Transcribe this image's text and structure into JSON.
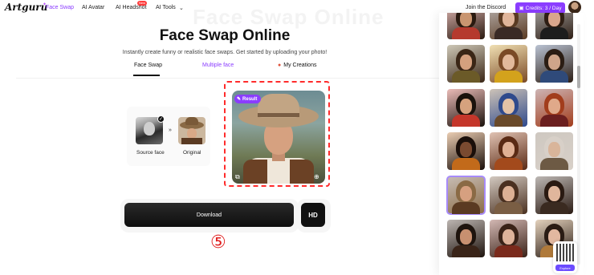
{
  "nav": {
    "logo": "Artguru",
    "items": [
      {
        "label": "Face Swap",
        "active": true
      },
      {
        "label": "AI Avatar"
      },
      {
        "label": "AI Headshot",
        "badge": "New"
      },
      {
        "label": "AI Tools"
      }
    ],
    "discord": "Join the Discord",
    "credits": "Credits: 3 / Day"
  },
  "hero": {
    "background_text": "Face Swap Online",
    "title": "Face Swap Online",
    "subtitle": "Instantly create funny or realistic face swaps. Get started by uploading your photo!"
  },
  "tabs": {
    "face_swap": "Face Swap",
    "multiple_face": "Multiple face",
    "my_creations": "My Creations"
  },
  "swap": {
    "source_label": "Source face",
    "original_label": "Original",
    "result_badge": "Result"
  },
  "actions": {
    "download": "Download",
    "hd": "HD",
    "step_marker": "⑤"
  },
  "explore": {
    "label": "Explore"
  },
  "colors": {
    "accent": "#8b3dff",
    "highlight": "#ff2b2b"
  },
  "gallery": {
    "thumbs": [
      {
        "skin": "#c99570",
        "hair": "#2a1a10",
        "body": "#b53a2e"
      },
      {
        "skin": "#e0b59a",
        "hair": "#5a3a22",
        "body": "#3a2a25"
      },
      {
        "skin": "#d9a68c",
        "hair": "#2e1e14",
        "body": "#1d1d1d"
      },
      {
        "skin": "#d4a07e",
        "hair": "#3a2616",
        "body": "#6b5a28"
      },
      {
        "skin": "#e2b99b",
        "hair": "#7a4a26",
        "body": "#d3a21c"
      },
      {
        "skin": "#cfa58a",
        "hair": "#2b1d14",
        "body": "#2f4a7a"
      },
      {
        "skin": "#d6a27e",
        "hair": "#1a120c",
        "body": "#c4362a"
      },
      {
        "skin": "#e3c2a6",
        "hair": "#2f4a8c",
        "body": "#6a4a2a"
      },
      {
        "skin": "#e0a98a",
        "hair": "#a23d1c",
        "body": "#6b1f1f"
      },
      {
        "skin": "#7a4a30",
        "hair": "#1a0f0a",
        "body": "#c26a1a"
      },
      {
        "skin": "#e0b094",
        "hair": "#5a2a14",
        "body": "#a34a1c"
      },
      {
        "skin": "#d9b59a",
        "hair": "#d8d0c8",
        "body": "#6d5a44"
      },
      {
        "skin": "#d6a080",
        "hair": "#8a6a45",
        "body": "#5a3a22"
      },
      {
        "skin": "#dcb094",
        "hair": "#4a3020",
        "body": "#7a5e44"
      },
      {
        "skin": "#e0b69c",
        "hair": "#2a1a12",
        "body": "#3a2a20"
      },
      {
        "skin": "#c89070",
        "hair": "#1e140e",
        "body": "#3a2418"
      },
      {
        "skin": "#deb29a",
        "hair": "#3a2218",
        "body": "#7a2a1c"
      },
      {
        "skin": "#e2b8a0",
        "hair": "#2a1c14",
        "body": "#b07a3a"
      }
    ]
  }
}
